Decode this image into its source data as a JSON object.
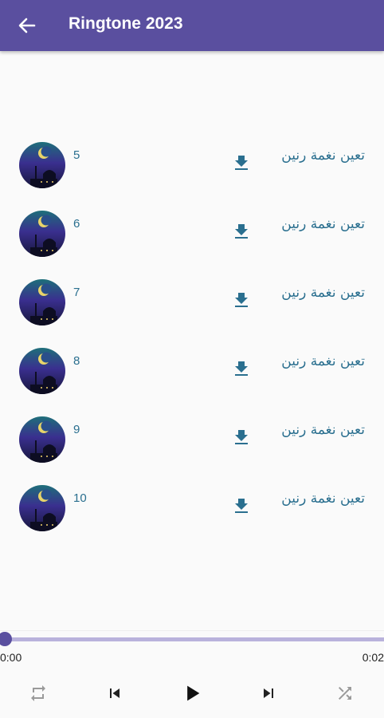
{
  "app_bar": {
    "title": "Ringtone 2023",
    "background": "#5a4f9f",
    "back_icon": "arrow-back-icon"
  },
  "list": {
    "items": [
      {
        "number": "5",
        "label": "تعين نغمة رنين",
        "thumbnail": "mosque-crescent-night",
        "action_icon": "download-icon"
      },
      {
        "number": "6",
        "label": "تعين نغمة رنين",
        "thumbnail": "mosque-crescent-night",
        "action_icon": "download-icon"
      },
      {
        "number": "7",
        "label": "تعين نغمة رنين",
        "thumbnail": "mosque-crescent-night",
        "action_icon": "download-icon"
      },
      {
        "number": "8",
        "label": "تعين نغمة رنين",
        "thumbnail": "mosque-crescent-night",
        "action_icon": "download-icon"
      },
      {
        "number": "9",
        "label": "تعين نغمة رنين",
        "thumbnail": "mosque-crescent-night",
        "action_icon": "download-icon"
      },
      {
        "number": "10",
        "label": "تعين نغمة رنين",
        "thumbnail": "mosque-crescent-night",
        "action_icon": "download-icon"
      }
    ],
    "text_color": "#2a6f8f"
  },
  "player": {
    "current_time": "0:00",
    "total_time": "0:02",
    "progress": 0,
    "accent": "#5a4f9f",
    "controls": [
      "repeat-icon",
      "skip-previous-icon",
      "play-icon",
      "skip-next-icon",
      "shuffle-icon"
    ]
  }
}
